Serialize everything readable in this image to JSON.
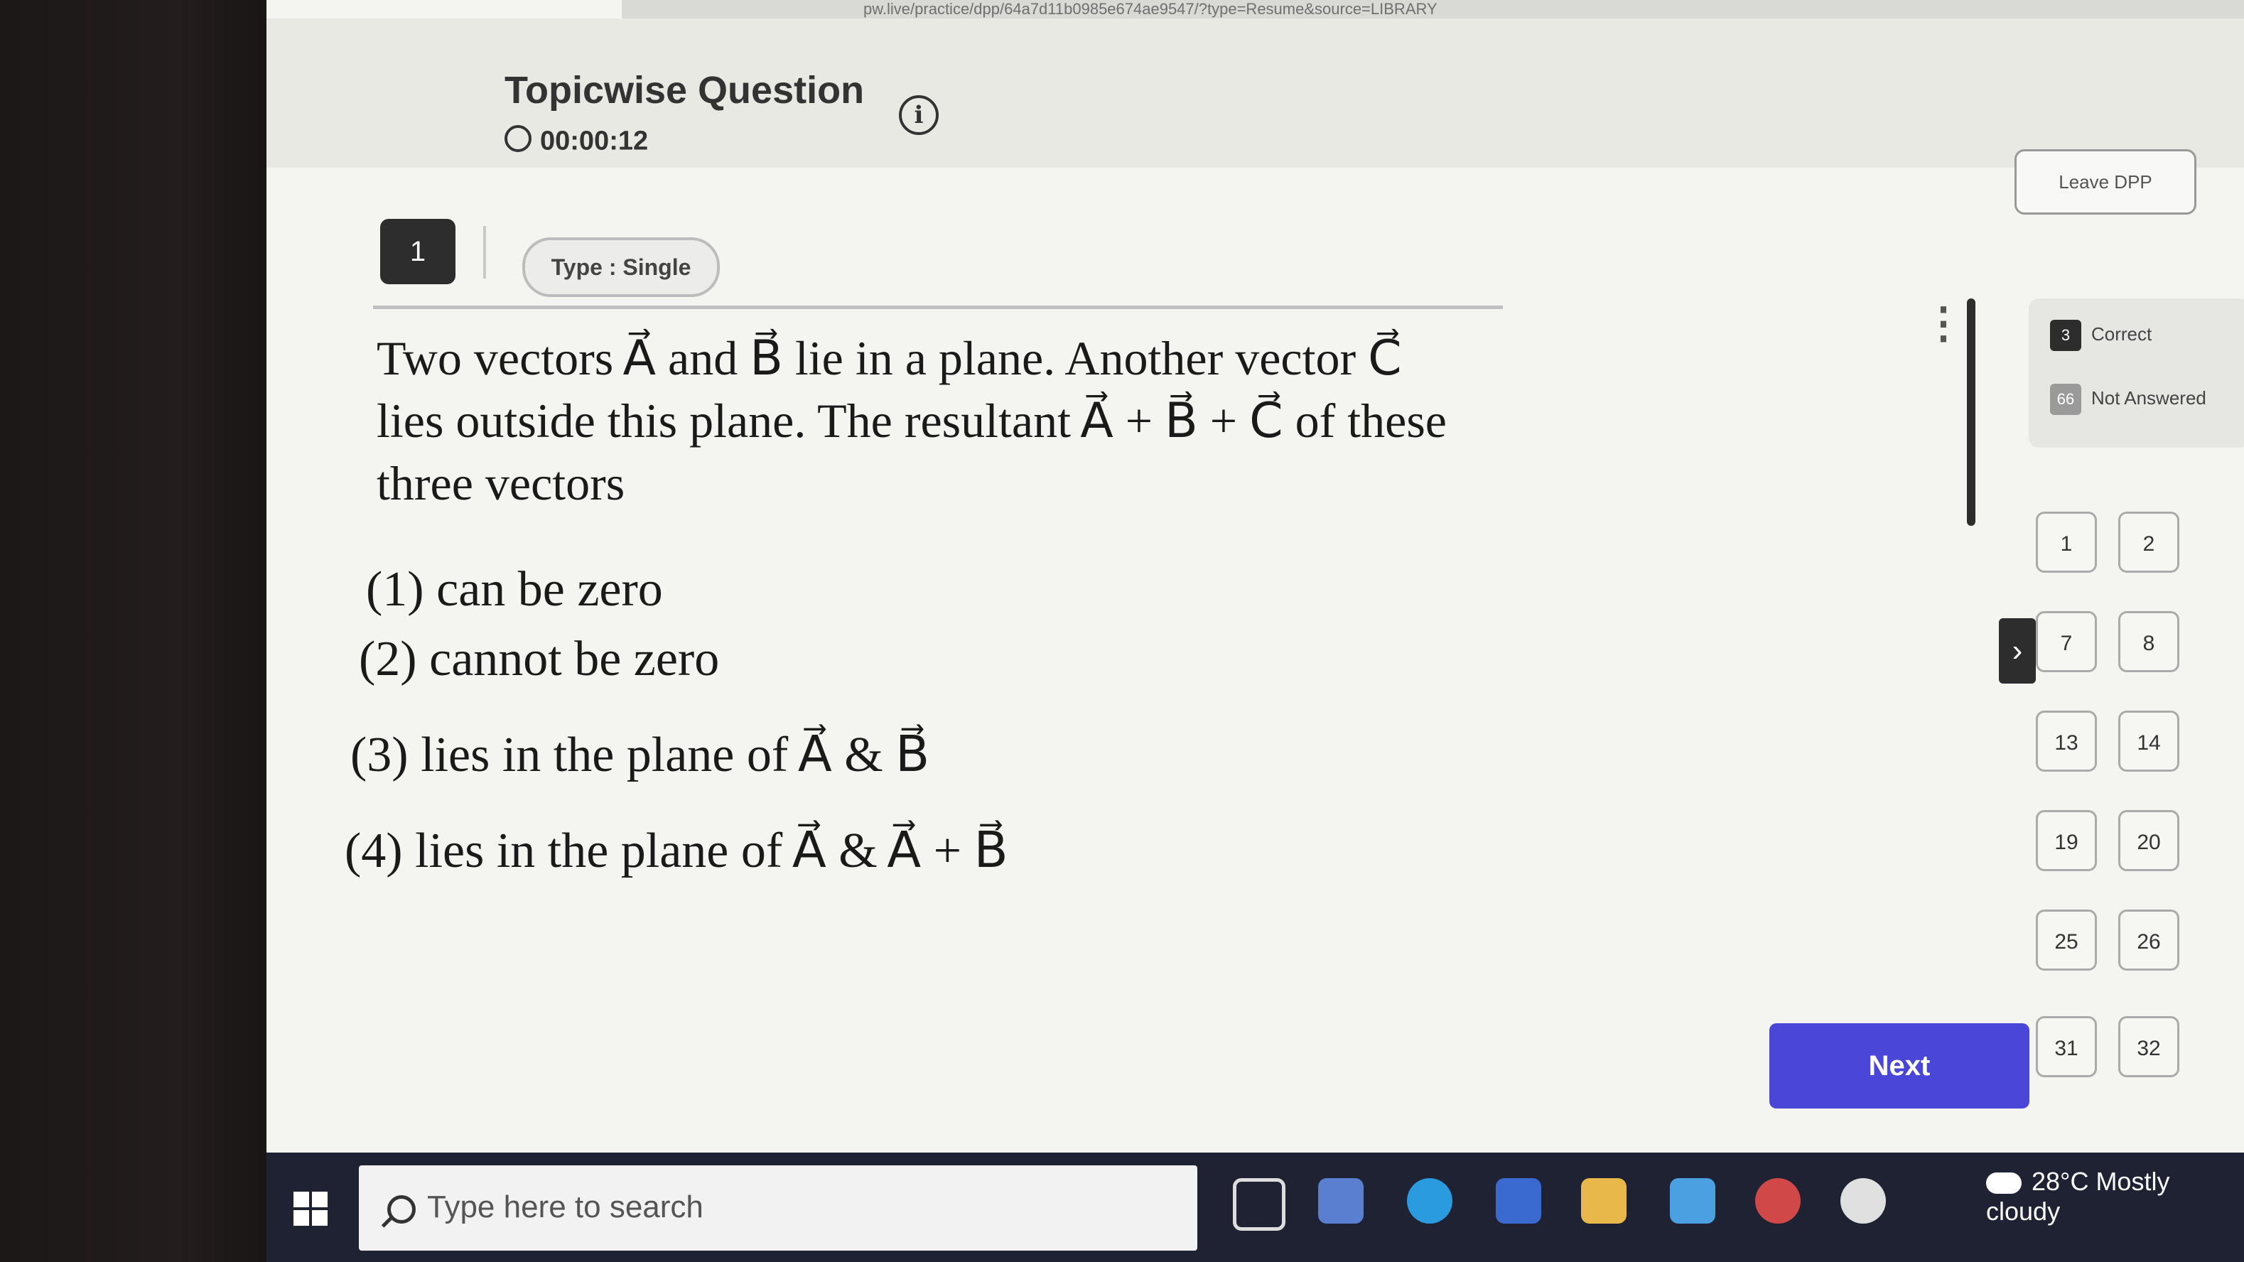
{
  "browser": {
    "url": "pw.live/practice/dpp/64a7d11b0985e674ae9547/?type=Resume&source=LIBRARY"
  },
  "header": {
    "title": "Topicwise Question",
    "timer": "00:00:12",
    "leave_label": "Leave DPP"
  },
  "question": {
    "number": "1",
    "type": "Type : Single",
    "text_line1": "Two vectors A⃗ and B⃗ lie in a plane. Another vector C⃗",
    "text_line2": "lies outside this plane. The resultant A⃗ + B⃗ + C⃗ of these",
    "text_line3": "three  vectors",
    "options": [
      "(1) can be zero",
      "(2) cannot be zero",
      "(3) lies in the plane of A⃗ & B⃗",
      "(4) lies in the plane of A⃗ & A⃗ + B⃗"
    ]
  },
  "legend": [
    {
      "count": "3",
      "label": "Correct",
      "color": "#2d2d2d"
    },
    {
      "count": "66",
      "label": "Not Answered",
      "color": "#9a9a9a"
    }
  ],
  "palette": [
    "1",
    "2",
    "7",
    "8",
    "13",
    "14",
    "19",
    "20",
    "25",
    "26",
    "31",
    "32"
  ],
  "next_label": "Next",
  "taskbar": {
    "search_placeholder": "Type here to search",
    "weather": "28°C  Mostly cloudy"
  }
}
